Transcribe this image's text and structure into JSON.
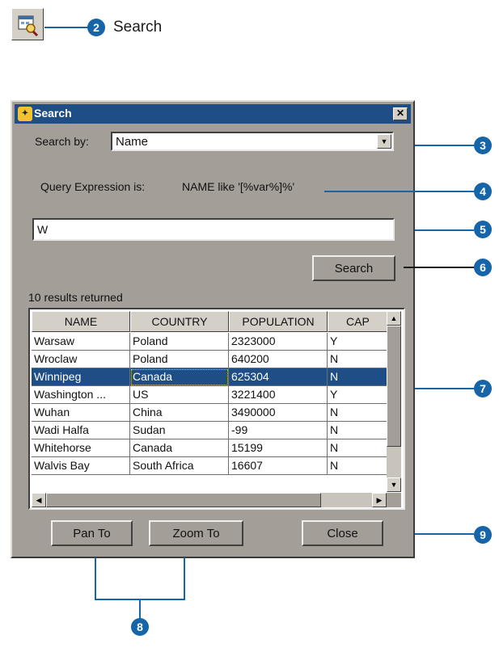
{
  "header": {
    "step_number": "2",
    "step_label": "Search"
  },
  "dialog": {
    "title": "Search",
    "close_glyph": "✕",
    "search_by_label": "Search by:",
    "search_by_value": "Name",
    "query_label": "Query Expression is:",
    "query_value": "NAME  like '[%var%]%'",
    "input_value": "W",
    "search_button": "Search",
    "results_text": "10 results returned",
    "columns": [
      "NAME",
      "COUNTRY",
      "POPULATION",
      "CAP"
    ],
    "rows": [
      [
        "Warsaw",
        "Poland",
        "2323000",
        "Y"
      ],
      [
        "Wroclaw",
        "Poland",
        "640200",
        "N"
      ],
      [
        "Winnipeg",
        "Canada",
        "625304",
        "N"
      ],
      [
        "Washington ...",
        "US",
        "3221400",
        "Y"
      ],
      [
        "Wuhan",
        "China",
        "3490000",
        "N"
      ],
      [
        "Wadi Halfa",
        "Sudan",
        "-99",
        "N"
      ],
      [
        "Whitehorse",
        "Canada",
        "15199",
        "N"
      ],
      [
        "Walvis Bay",
        "South Africa",
        "16607",
        "N"
      ]
    ],
    "selected_row": 2,
    "pan_to_button": "Pan To",
    "zoom_to_button": "Zoom To",
    "close_button": "Close"
  },
  "callouts": [
    "3",
    "4",
    "5",
    "6",
    "7",
    "8",
    "9"
  ],
  "colors": {
    "callout": "#1565a8",
    "titlebar": "#1f4e86",
    "dialog_bg": "#a49e98",
    "selection": "#1f4e86"
  },
  "icons": {
    "toolbar": "search-tool-icon",
    "title": "arcexplorer-app-icon"
  }
}
